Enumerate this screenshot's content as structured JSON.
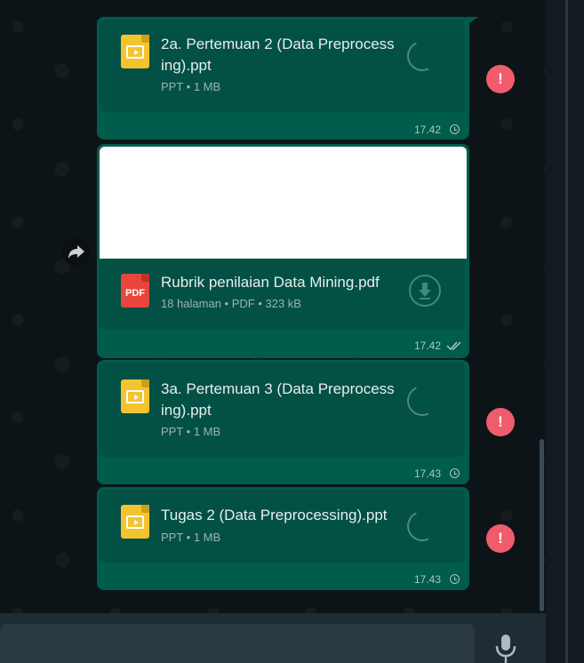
{
  "messages": [
    {
      "file_name": "2a. Pertemuan 2 (Data Preprocess ing).ppt",
      "meta": "PPT • 1 MB",
      "time": "17.42",
      "status": "pending",
      "icon": "ppt-file-icon",
      "error": "!"
    },
    {
      "file_name": "Rubrik penilaian Data Mining.pdf",
      "meta": "18 halaman • PDF • 323 kB",
      "time": "17.42",
      "status": "sent",
      "icon": "pdf-file-icon",
      "icon_label": "PDF"
    },
    {
      "file_name": "3a. Pertemuan 3 (Data Preprocess ing).ppt",
      "meta": "PPT • 1 MB",
      "time": "17.43",
      "status": "pending",
      "icon": "ppt-file-icon",
      "error": "!"
    },
    {
      "file_name": "Tugas 2 (Data Preprocessing).ppt",
      "meta": "PPT • 1 MB",
      "time": "17.43",
      "status": "pending",
      "icon": "ppt-file-icon",
      "error": "!"
    }
  ],
  "colors": {
    "bubble": "#005c4b",
    "card": "#025144",
    "error": "#f15c6d",
    "ppt": "#f4c430",
    "pdf": "#e8453c"
  }
}
